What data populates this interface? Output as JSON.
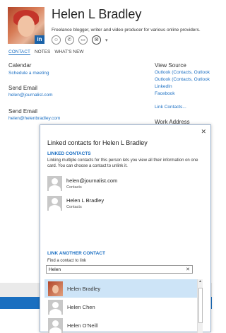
{
  "contact": {
    "name": "Helen L Bradley",
    "bio": "Freelance blogger, writer and video producer for various online providers.",
    "badge": "in"
  },
  "tabs": [
    {
      "label": "CONTACT",
      "active": true
    },
    {
      "label": "NOTES",
      "active": false
    },
    {
      "label": "WHAT'S NEW",
      "active": false
    }
  ],
  "left": {
    "calendar_title": "Calendar",
    "schedule_link": "Schedule a meeting",
    "send_email_1_title": "Send Email",
    "email_1": "helen@journalist.com",
    "send_email_2_title": "Send Email",
    "email_2": "helen@helenbradley.com"
  },
  "right": {
    "view_source_title": "View Source",
    "sources": [
      "Outlook (Contacts, Outlook",
      "Outlook (Contacts, Outlook",
      "LinkedIn",
      "Facebook"
    ],
    "link_contacts": "Link Contacts...",
    "work_address_title": "Work Address"
  },
  "dialog": {
    "close": "✕",
    "title": "Linked contacts for Helen L Bradley",
    "linked_heading": "LINKED CONTACTS",
    "description": "Linking multiple contacts for this person lets you view all their information on one card. You can choose a contact to unlink it.",
    "linked": [
      {
        "name": "helen@journalist.com",
        "sub": "Contacts"
      },
      {
        "name": "Helen L Bradley",
        "sub": "Contacts"
      }
    ],
    "link_another_heading": "LINK ANOTHER CONTACT",
    "find_label": "Find a contact to link",
    "search_value": "Helen",
    "search_clear": "✕",
    "results": [
      "Helen Bradley",
      "Helen Chen",
      "Helen O'Neill"
    ]
  }
}
